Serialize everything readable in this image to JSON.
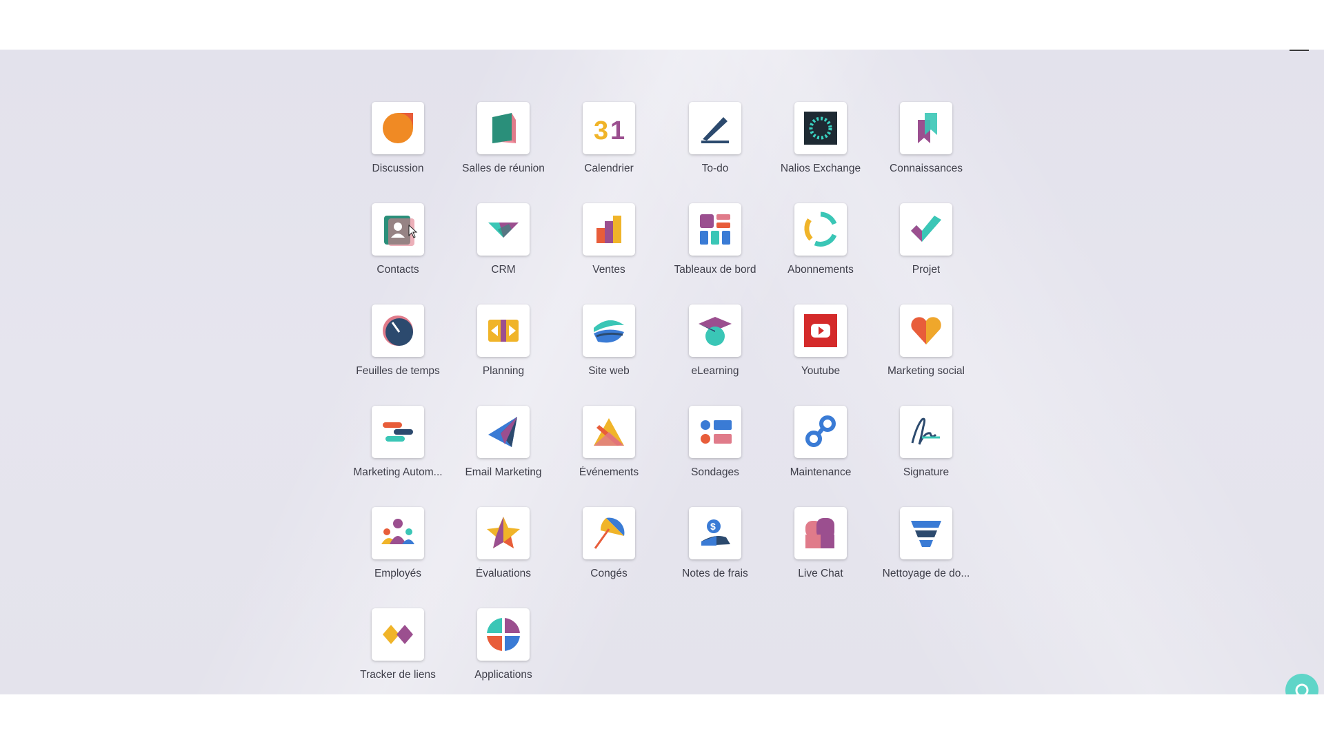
{
  "apps": [
    {
      "label": "Discussion",
      "icon": "discussion-icon"
    },
    {
      "label": "Salles de réunion",
      "icon": "meeting-rooms-icon"
    },
    {
      "label": "Calendrier",
      "icon": "calendar-icon"
    },
    {
      "label": "To-do",
      "icon": "todo-icon"
    },
    {
      "label": "Nalios Exchange",
      "icon": "exchange-icon"
    },
    {
      "label": "Connaissances",
      "icon": "knowledge-icon"
    },
    {
      "label": "Contacts",
      "icon": "contacts-icon"
    },
    {
      "label": "CRM",
      "icon": "crm-icon"
    },
    {
      "label": "Ventes",
      "icon": "sales-icon"
    },
    {
      "label": "Tableaux de bord",
      "icon": "dashboards-icon"
    },
    {
      "label": "Abonnements",
      "icon": "subscriptions-icon"
    },
    {
      "label": "Projet",
      "icon": "project-icon"
    },
    {
      "label": "Feuilles de temps",
      "icon": "timesheets-icon"
    },
    {
      "label": "Planning",
      "icon": "planning-icon"
    },
    {
      "label": "Site web",
      "icon": "website-icon"
    },
    {
      "label": "eLearning",
      "icon": "elearning-icon"
    },
    {
      "label": "Youtube",
      "icon": "youtube-icon"
    },
    {
      "label": "Marketing social",
      "icon": "social-marketing-icon"
    },
    {
      "label": "Marketing Autom...",
      "icon": "marketing-automation-icon"
    },
    {
      "label": "Email Marketing",
      "icon": "email-marketing-icon"
    },
    {
      "label": "Événements",
      "icon": "events-icon"
    },
    {
      "label": "Sondages",
      "icon": "surveys-icon"
    },
    {
      "label": "Maintenance",
      "icon": "maintenance-icon"
    },
    {
      "label": "Signature",
      "icon": "signature-icon"
    },
    {
      "label": "Employés",
      "icon": "employees-icon"
    },
    {
      "label": "Évaluations",
      "icon": "appraisals-icon"
    },
    {
      "label": "Congés",
      "icon": "time-off-icon"
    },
    {
      "label": "Notes de frais",
      "icon": "expenses-icon"
    },
    {
      "label": "Live Chat",
      "icon": "live-chat-icon"
    },
    {
      "label": "Nettoyage de do...",
      "icon": "data-cleaning-icon"
    },
    {
      "label": "Tracker de liens",
      "icon": "link-tracker-icon"
    },
    {
      "label": "Applications",
      "icon": "apps-icon"
    }
  ],
  "colors": {
    "background": "#e4e3ec",
    "label": "#3f3f4a",
    "chat_bubble": "#5fd5c8"
  }
}
